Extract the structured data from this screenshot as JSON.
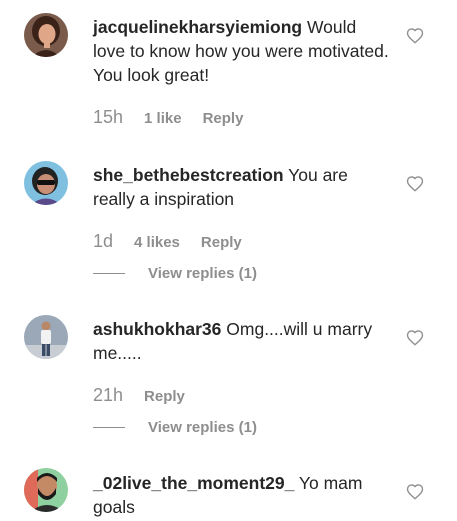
{
  "comments": [
    {
      "username": "jacquelinekharsyiemiong",
      "text": "Would love to know how you were motivated. You look great!",
      "time": "15h",
      "likes": "1 like",
      "reply_label": "Reply",
      "avatar_icon": "avatar-woman-portrait",
      "colors": {
        "bg": "#7a5a4a",
        "skin": "#e0a688",
        "hair": "#3a2218"
      }
    },
    {
      "username": "she_bethebestcreation",
      "text": "You are really a inspiration",
      "time": "1d",
      "likes": "4 likes",
      "reply_label": "Reply",
      "view_replies": "View replies (1)",
      "avatar_icon": "avatar-person-sunglasses",
      "colors": {
        "bg": "#7fbfe0",
        "skin": "#c98f76",
        "hair": "#222222"
      }
    },
    {
      "username": "ashukhokhar36",
      "text": "Omg....will u marry me.....",
      "time": "21h",
      "reply_label": "Reply",
      "view_replies": "View replies (1)",
      "avatar_icon": "avatar-man-standing",
      "colors": {
        "bg": "#9aa8b8",
        "skin": "#b98866",
        "hair": "#2a2a2a"
      }
    },
    {
      "username": "_02live_the_moment29_",
      "text": "Yo mam goals",
      "avatar_icon": "avatar-man-beard",
      "colors": {
        "bg": "#8fd0a0",
        "skin": "#c48a66",
        "hair": "#1a1a1a"
      }
    }
  ],
  "icons": {
    "like": "heart-outline-icon"
  }
}
